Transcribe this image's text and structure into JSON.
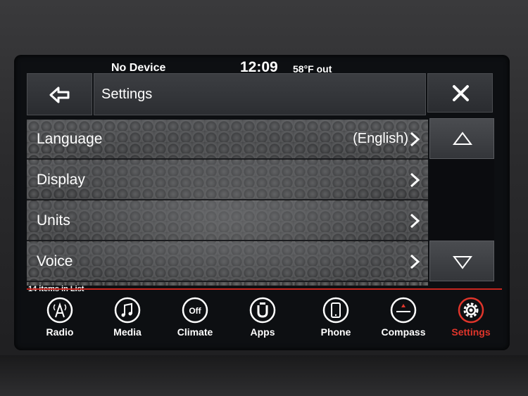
{
  "status": {
    "device": "No Device",
    "time": "12:09",
    "temperature": "58°F out"
  },
  "header": {
    "title": "Settings"
  },
  "settings_list": [
    {
      "label": "Language",
      "value": "(English)"
    },
    {
      "label": "Display",
      "value": ""
    },
    {
      "label": "Units",
      "value": ""
    },
    {
      "label": "Voice",
      "value": ""
    }
  ],
  "list_count": "14 items in List",
  "nav": [
    {
      "label": "Radio",
      "icon": "radio-tower-icon"
    },
    {
      "label": "Media",
      "icon": "music-note-icon"
    },
    {
      "label": "Climate",
      "icon": "climate-off-icon",
      "icon_text": "Off"
    },
    {
      "label": "Apps",
      "icon": "apps-icon"
    },
    {
      "label": "Phone",
      "icon": "phone-icon"
    },
    {
      "label": "Compass",
      "icon": "compass-icon"
    },
    {
      "label": "Settings",
      "icon": "gear-icon",
      "active": true
    }
  ],
  "colors": {
    "accent": "#e0352b",
    "text": "#ffffff"
  }
}
